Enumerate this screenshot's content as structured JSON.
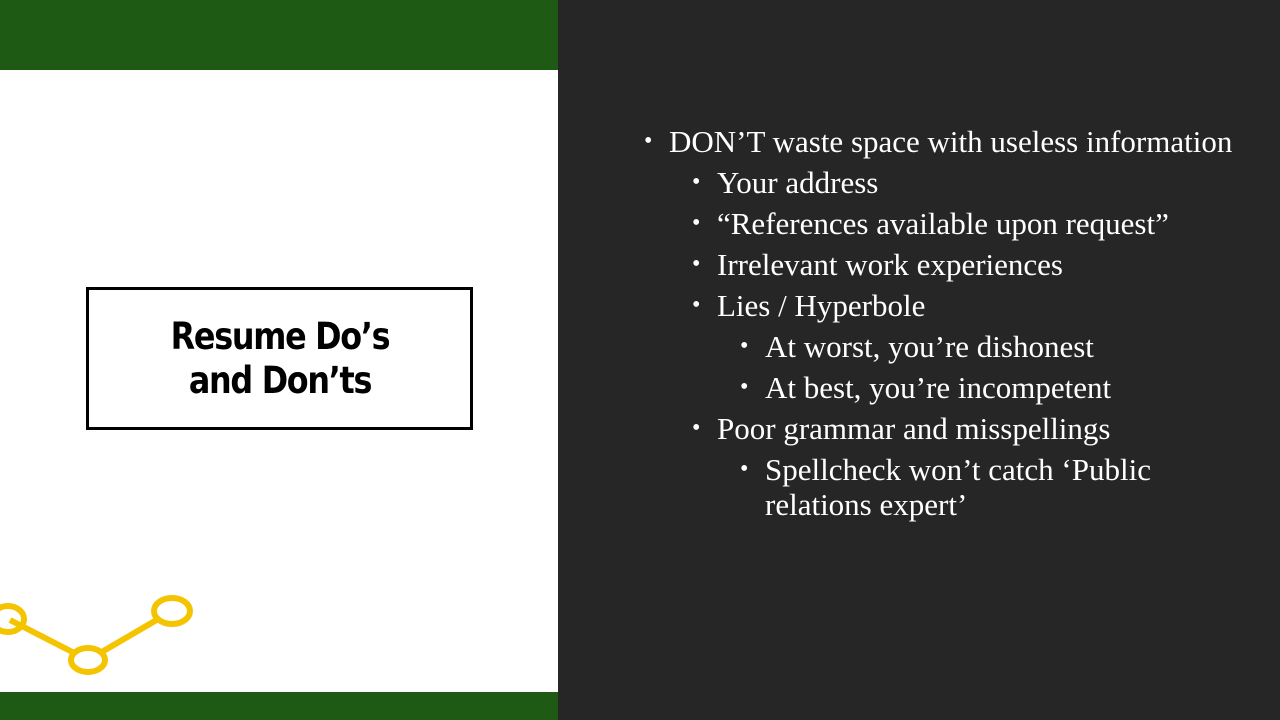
{
  "slide": {
    "title": "Resume Do’s and Don’ts",
    "accent_color": "#1e5a14",
    "panel_color": "#262626",
    "decoration_color": "#f5c400",
    "decoration_icon": "connected-dots-line-icon",
    "bullets": [
      {
        "level": 1,
        "text": "DON’T  waste space with useless information"
      },
      {
        "level": 2,
        "text": "Your address"
      },
      {
        "level": 2,
        "text": "“References available upon request”"
      },
      {
        "level": 2,
        "text": "Irrelevant work experiences"
      },
      {
        "level": 2,
        "text": "Lies / Hyperbole"
      },
      {
        "level": 3,
        "text": "At worst, you’re dishonest"
      },
      {
        "level": 3,
        "text": "At best, you’re incompetent"
      },
      {
        "level": 2,
        "text": "Poor grammar and misspellings"
      },
      {
        "level": 3,
        "text": "Spellcheck won’t catch ‘Public relations expert’"
      }
    ]
  }
}
